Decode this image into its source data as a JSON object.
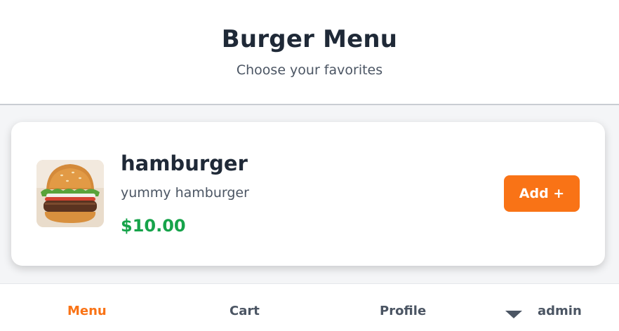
{
  "header": {
    "title": "Burger Menu",
    "subtitle": "Choose your favorites"
  },
  "menu_items": [
    {
      "name": "hamburger",
      "description": "yummy hamburger",
      "price": "$10.00",
      "add_label": "Add +",
      "image_icon": "hamburger-photo"
    }
  ],
  "bottom_nav": {
    "items": [
      {
        "label": "Menu",
        "active": true
      },
      {
        "label": "Cart",
        "active": false
      },
      {
        "label": "Profile",
        "active": false
      }
    ],
    "user": {
      "name": "admin",
      "icon": "caret-down-icon"
    }
  },
  "colors": {
    "accent": "#f97316",
    "price": "#16a34a",
    "title": "#1f2937",
    "muted": "#4b5563"
  }
}
